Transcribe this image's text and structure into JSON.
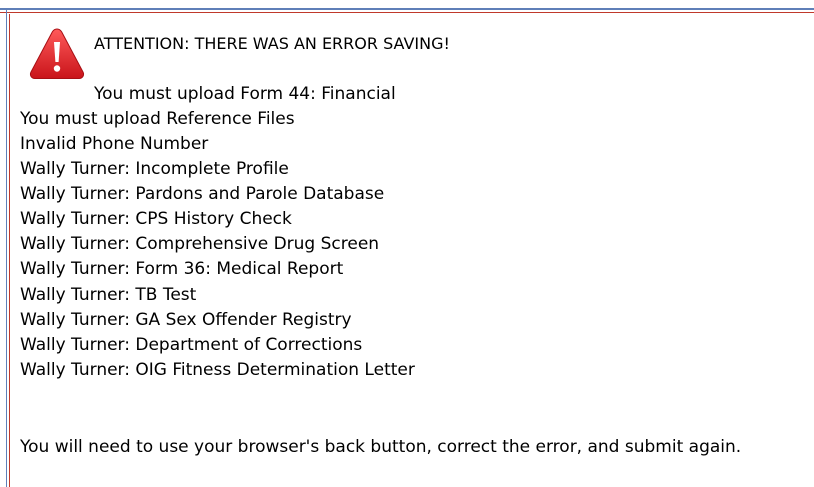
{
  "alert": {
    "heading": "ATTENTION: THERE WAS AN ERROR SAVING!",
    "icon": "warning-icon",
    "colors": {
      "icon_fill": "#e0262b",
      "icon_mark": "#ffffff",
      "frame_blue": "#5f7fb8",
      "frame_red": "#c0392b"
    }
  },
  "errors": [
    "You must upload Form 44: Financial",
    "You must upload Reference Files",
    "Invalid Phone Number",
    "Wally Turner: Incomplete Profile",
    "Wally Turner: Pardons and Parole Database",
    "Wally Turner: CPS History Check",
    "Wally Turner: Comprehensive Drug Screen",
    "Wally Turner: Form 36: Medical Report",
    "Wally Turner: TB Test",
    "Wally Turner: GA Sex Offender Registry",
    "Wally Turner: Department of Corrections",
    "Wally Turner: OIG Fitness Determination Letter"
  ],
  "footer": {
    "instruction": "You will need to use your browser's back button, correct the error, and submit again."
  }
}
